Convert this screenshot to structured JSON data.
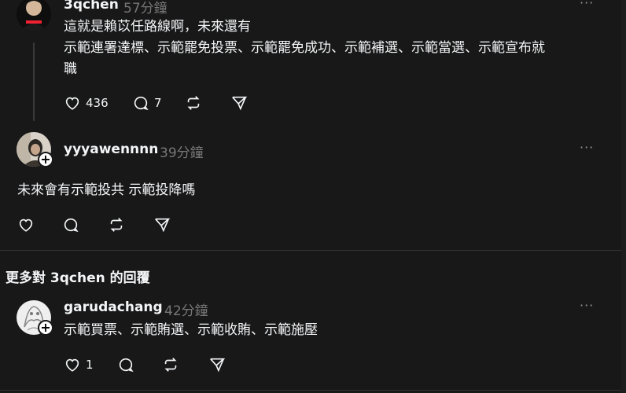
{
  "posts": [
    {
      "username": "3qchen",
      "time": "57分鐘",
      "text_line1": "這就是賴苡任路線啊，未來還有",
      "text_line2": "示範連署達標、示範罷免投票、示範罷免成功、示範補選、示範當選、示範宣布就",
      "text_line3": "職",
      "likes": "436",
      "replies": "7"
    },
    {
      "username": "yyyawennnn",
      "time": "39分鐘",
      "text": "未來會有示範投共 示範投降嗎"
    },
    {
      "username": "garudachang",
      "time": "42分鐘",
      "text": "示範買票、示範賄選、示範收賄、示範施壓",
      "likes": "1"
    }
  ],
  "section": {
    "title": "更多對 3qchen 的回覆"
  },
  "icons": {
    "like": "heart-icon",
    "reply": "comment-icon",
    "repost": "repost-icon",
    "share": "send-icon",
    "more": "more-icon",
    "follow": "plus-icon"
  },
  "colors": {
    "background": "#181818",
    "text": "#f3f5f7",
    "muted": "#777777",
    "divider": "#333333"
  },
  "more_label": "···",
  "plus_label": "+"
}
